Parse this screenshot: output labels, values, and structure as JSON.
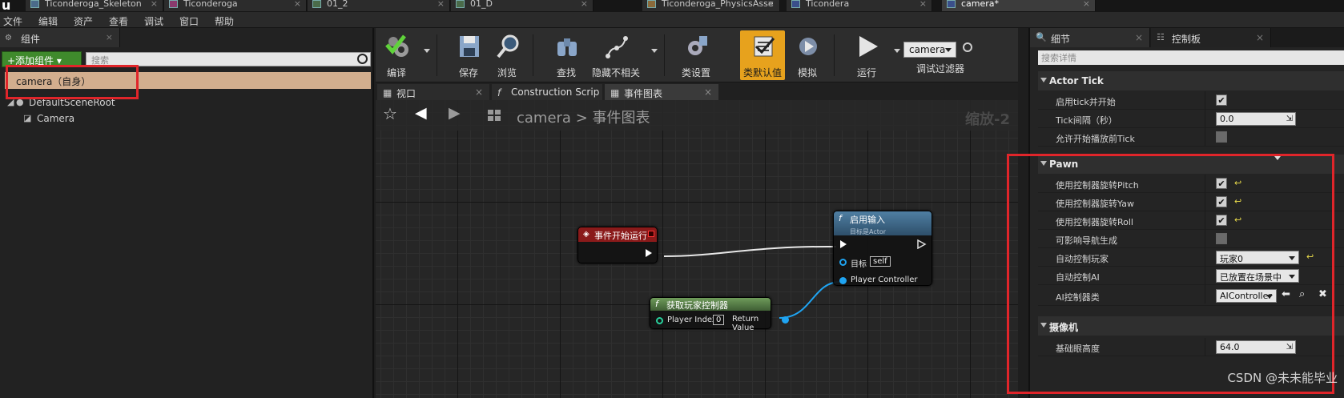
{
  "doc_tabs": [
    {
      "label": "Ticonderoga_Skeleton"
    },
    {
      "label": "Ticonderoga"
    },
    {
      "label": "01_2"
    },
    {
      "label": "01_D"
    },
    {
      "label": "Ticonderoga_PhysicsAsse"
    },
    {
      "label": "Ticondera"
    },
    {
      "label": "camera*"
    }
  ],
  "menu": [
    "文件",
    "编辑",
    "资产",
    "查看",
    "调试",
    "窗口",
    "帮助"
  ],
  "components_panel": {
    "tab_label": "组件",
    "add_button": "+添加组件 ▾",
    "search_placeholder": "搜索",
    "selected_item": "camera（自身）",
    "tree": [
      "DefaultSceneRoot",
      "Camera"
    ]
  },
  "toolbar": {
    "buttons": [
      "编译",
      "保存",
      "浏览",
      "查找",
      "隐藏不相关",
      "类设置",
      "类默认值",
      "模拟",
      "运行"
    ],
    "debug_object": "camera",
    "debug_filter_label": "调试过滤器"
  },
  "graph_tabs": [
    "视口",
    "Construction Scrip",
    "事件图表"
  ],
  "graph": {
    "breadcrumb_root": "camera",
    "breadcrumb_sep": ">",
    "breadcrumb_leaf": "事件图表",
    "zoom": "缩放-2",
    "nodes": {
      "event_begin": {
        "title": "事件开始运行"
      },
      "enable_input": {
        "title": "启用输入",
        "subtitle": "目标是Actor",
        "target_label": "目标",
        "target_value": "self",
        "pc_label": "Player Controller"
      },
      "get_player_controller": {
        "title": "获取玩家控制器",
        "index_label": "Player Index",
        "index_value": "0",
        "return_label": "Return Value"
      }
    }
  },
  "details_panel": {
    "tab_details": "细节",
    "tab_control": "控制板",
    "search_placeholder": "搜索详情",
    "actor_tick": {
      "header": "Actor Tick",
      "rows": [
        {
          "label": "启用tick并开始",
          "checked": true
        },
        {
          "label": "Tick间隔（秒）",
          "value": "0.0"
        },
        {
          "label": "允许开始播放前Tick",
          "checked": false
        }
      ]
    },
    "pawn": {
      "header": "Pawn",
      "rows": [
        {
          "label": "使用控制器旋转Pitch",
          "checked": true
        },
        {
          "label": "使用控制器旋转Yaw",
          "checked": true
        },
        {
          "label": "使用控制器旋转Roll",
          "checked": true
        },
        {
          "label": "可影响导航生成",
          "checked": false
        },
        {
          "label": "自动控制玩家",
          "value": "玩家0"
        },
        {
          "label": "自动控制AI",
          "value": "已放置在场景中"
        },
        {
          "label": "AI控制器类",
          "value": "AIController"
        }
      ]
    },
    "camera": {
      "header": "摄像机",
      "rows": [
        {
          "label": "基础眼高度",
          "value": "64.0"
        }
      ]
    }
  },
  "watermark": "CSDN @未未能毕业",
  "colors": {
    "selection": "#d2ae8e",
    "highlight_box": "#e0252a",
    "active_tool": "#e7a21d",
    "exec_node_head": "#8a1a1a",
    "function_node_head": "#3f6b8a",
    "pure_node_head": "#5b7f4a",
    "data_wire": "#1fa4f2"
  }
}
